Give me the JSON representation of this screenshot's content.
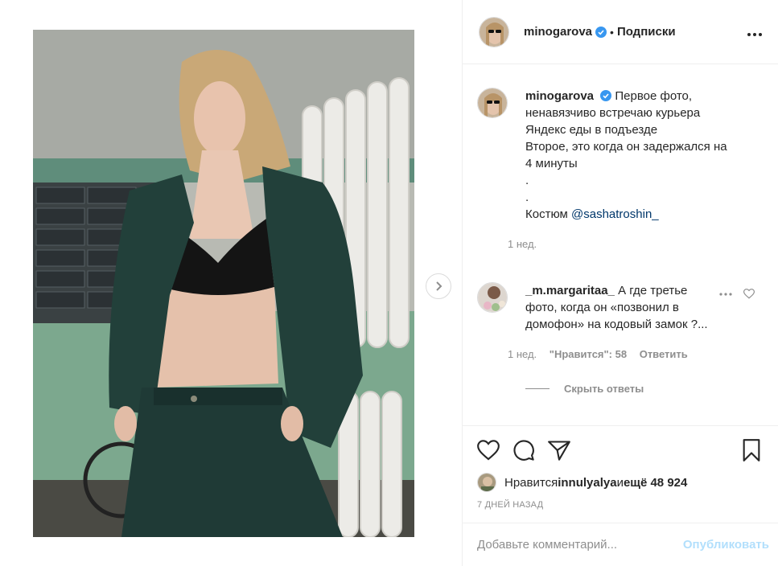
{
  "post": {
    "author": "minogarova",
    "follow_status": "Подписки",
    "separator": "•",
    "caption_lines": [
      "Первое фото,",
      "ненавязчиво встречаю курьера",
      "Яндекс еды в подъезде",
      "Второе, это когда он задержался на",
      "4 минуты",
      ".",
      "."
    ],
    "caption_suit_prefix": "Костюм ",
    "caption_mention": "@sashatroshin_",
    "caption_time": "1 нед."
  },
  "reply": {
    "author": "_m.margaritaa_",
    "text": "А где третье фото, когда он «позвонил в домофон» на кодовый замок ?...",
    "time": "1 нед.",
    "likes": "\"Нравится\": 58",
    "reply_label": "Ответить",
    "hide_replies": "Скрыть ответы"
  },
  "actions": {
    "liked_prefix": "Нравится ",
    "liked_user": "innulyalya",
    "liked_middle": " и ",
    "liked_others": "ещё 48 924",
    "timestamp": "7 ДНЕЙ НАЗАД"
  },
  "comment_box": {
    "placeholder": "Добавьте комментарий...",
    "publish_label": "Опубликовать"
  },
  "colors": {
    "verified": "#3897f0",
    "link": "#00376b",
    "muted": "#8e8e8e",
    "publish_disabled": "#b2dffc"
  },
  "icons": [
    "chevron-right-icon",
    "verified-badge-icon",
    "more-options-icon",
    "heart-icon",
    "comment-icon",
    "share-icon",
    "bookmark-icon"
  ]
}
